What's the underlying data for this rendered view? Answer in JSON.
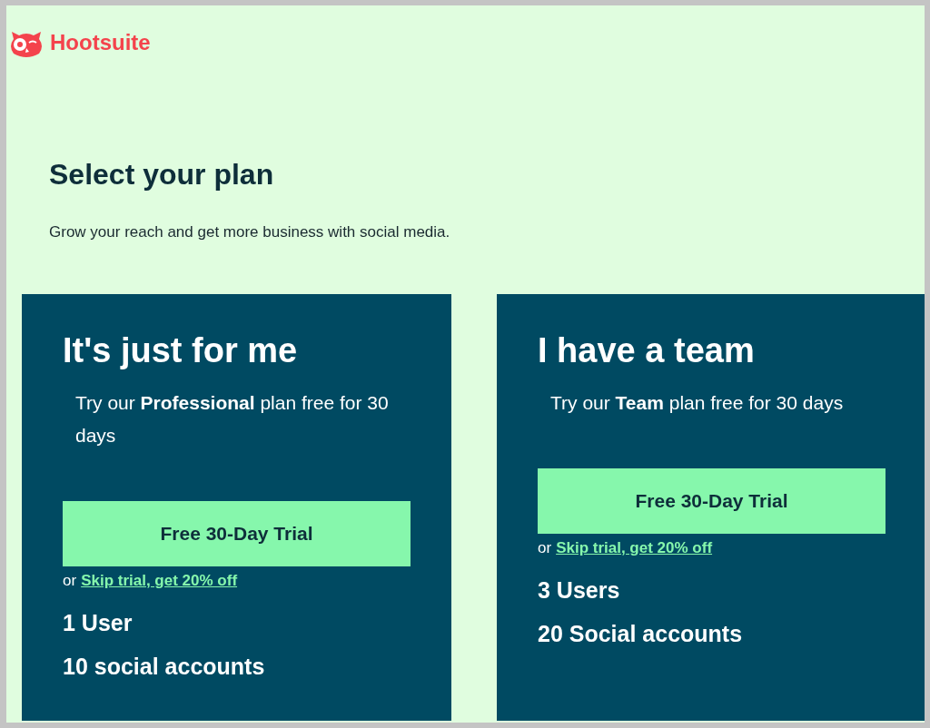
{
  "logo": {
    "text": "Hootsuite"
  },
  "heading": "Select your plan",
  "subtitle": "Grow your reach and get more business with social media.",
  "plans": [
    {
      "title": "It's just for me",
      "description": "Try our **Professional** plan free for 30 days",
      "button": "Free 30-Day Trial",
      "or_text": "or",
      "link": "Skip trial, get 20% off",
      "features": [
        "1 User",
        "10 social accounts"
      ]
    },
    {
      "title": "I have a team",
      "description": "Try our **Team** plan free for 30 days",
      "button": "Free 30-Day Trial",
      "or_text": "or",
      "link": "Skip trial, get 20% off",
      "features": [
        "3 Users",
        "20 Social accounts"
      ]
    }
  ]
}
